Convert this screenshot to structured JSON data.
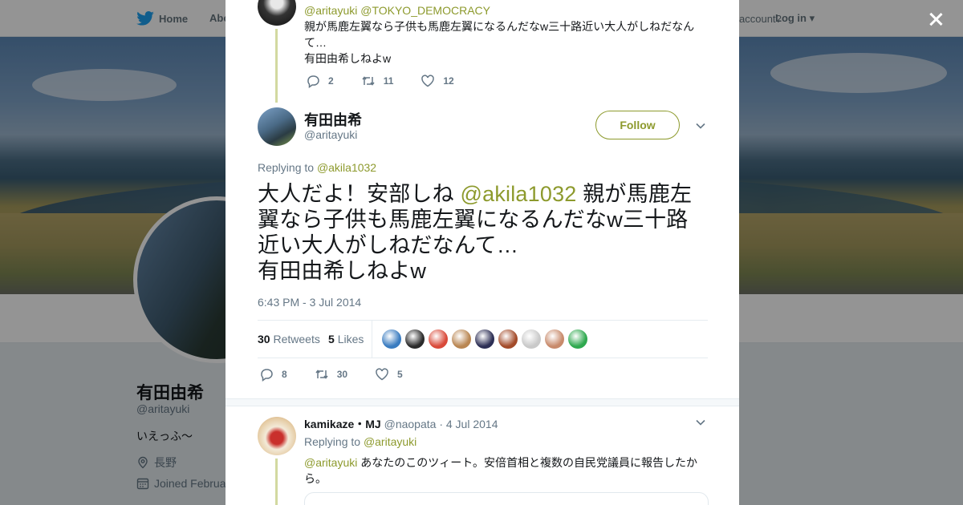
{
  "nav": {
    "home_label": "Home",
    "about_label": "Abo",
    "account_prompt": "account?",
    "login_label": "Log in"
  },
  "profile_bg": {
    "name": "有田由希",
    "handle": "@aritayuki",
    "bio": "いえっふ〜",
    "location": "長野",
    "joined": "Joined Februa"
  },
  "parent_tweet": {
    "reply_mentions": [
      "@aritayuki",
      "@TOKYO_DEMOCRACY"
    ],
    "text_line1": "親が馬鹿左翼なら子供も馬鹿左翼になるんだなw三十路近い大人がしねだなん",
    "text_line2": "て…",
    "text_line3": "有田由希しねよw",
    "replies": "2",
    "retweets": "11",
    "likes": "12"
  },
  "main_tweet": {
    "name": "有田由希",
    "handle": "@aritayuki",
    "follow_label": "Follow",
    "replying_prefix": "Replying to",
    "replying_to": "@akila1032",
    "text_part1": "大人だよ！安部しね",
    "text_mention": "@akila1032",
    "text_part2": "親が馬鹿左翼なら子供も馬鹿左翼になるんだなw三十路近い大人がしねだなんて…",
    "text_line_last": "有田由希しねよw",
    "timestamp": "6:43 PM - 3 Jul 2014",
    "retweet_count": "30",
    "retweet_label": "Retweets",
    "like_count": "5",
    "like_label": "Likes",
    "actions": {
      "replies": "8",
      "retweets": "30",
      "likes": "5"
    },
    "liker_colors": [
      "#3a7cc0",
      "#2b2b2b",
      "#d94a3a",
      "#b98652",
      "#2d2f55",
      "#a34b2a",
      "#c9c9c9",
      "#c88a6b",
      "#2fa94f"
    ]
  },
  "reply_tweet": {
    "name": "kamikaze・MJ",
    "handle": "@naopata",
    "date": "· 4 Jul 2014",
    "replying_prefix": "Replying to",
    "replying_to": "@aritayuki",
    "mention": "@aritayuki",
    "text": "あなたのこのツィート。安倍首相と複数の自民党議員に報告したか",
    "text_line2": "ら。"
  },
  "colors": {
    "accent": "#8d9a2d",
    "twitter_blue": "#1da1f2",
    "muted": "#657786"
  }
}
